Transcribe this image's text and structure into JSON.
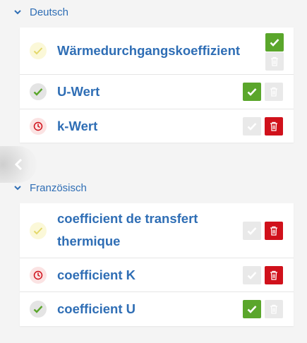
{
  "sections": [
    {
      "title": "Deutsch",
      "terms": [
        {
          "label": "Wärmedurchgangskoeffizient",
          "status": "pending",
          "approved": true,
          "deletable": false
        },
        {
          "label": "U-Wert",
          "status": "ok",
          "approved": true,
          "deletable": false
        },
        {
          "label": "k-Wert",
          "status": "reject",
          "approved": false,
          "deletable": true
        }
      ]
    },
    {
      "title": "Französisch",
      "terms": [
        {
          "label_line1": "coefficient de transfert",
          "label_line2": "thermique",
          "status": "pending",
          "approved": false,
          "deletable": true
        },
        {
          "label": "coefficient K",
          "status": "reject",
          "approved": false,
          "deletable": true
        },
        {
          "label": "coefficient U",
          "status": "ok",
          "approved": true,
          "deletable": false
        }
      ]
    }
  ],
  "icons": {
    "section_toggle": "chevron-down-icon",
    "collapse": "chevron-left-icon",
    "status_ok": "check-icon",
    "status_pending": "check-outline-icon",
    "status_reject": "clock-icon",
    "approve": "check-icon",
    "delete": "trash-icon"
  },
  "colors": {
    "link": "#2f6eb5",
    "approve": "#5aa62b",
    "delete": "#d0111b",
    "inactive": "#e9e9e9"
  }
}
